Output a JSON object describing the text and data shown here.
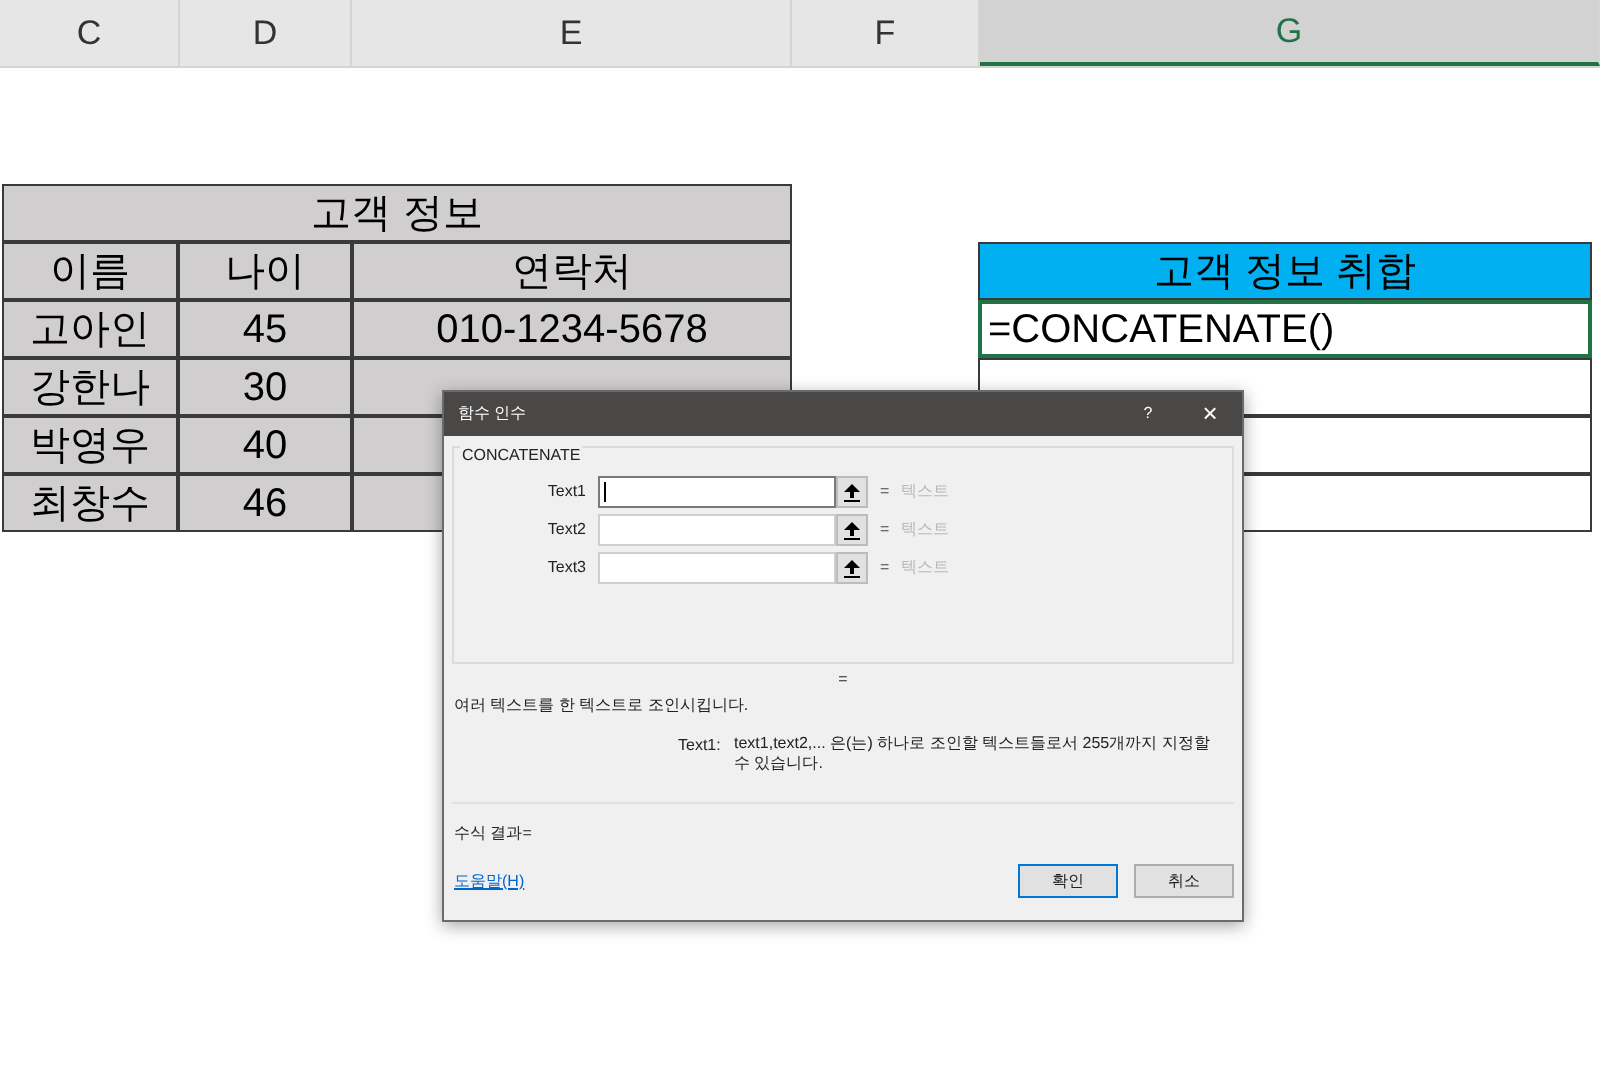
{
  "column_headers": [
    {
      "label": "C",
      "selected": false
    },
    {
      "label": "D",
      "selected": false
    },
    {
      "label": "E",
      "selected": false
    },
    {
      "label": "F",
      "selected": false
    },
    {
      "label": "G",
      "selected": true
    }
  ],
  "customer_table": {
    "title": "고객 정보",
    "columns": [
      "이름",
      "나이",
      "연락처"
    ],
    "rows": [
      {
        "name": "고아인",
        "age": "45",
        "phone": "010-1234-5678"
      },
      {
        "name": "강한나",
        "age": "30"
      },
      {
        "name": "박영우",
        "age": "40"
      },
      {
        "name": "최창수",
        "age": "46"
      }
    ]
  },
  "merge_table": {
    "title": "고객 정보 취합",
    "cells": [
      {
        "value": "=CONCATENATE()",
        "selected": true
      },
      {
        "selected": false
      },
      {
        "selected": false
      },
      {
        "selected": false
      }
    ]
  },
  "dialog": {
    "title": "함수 인수",
    "help": "?",
    "close": "×",
    "function_name": "CONCATENATE",
    "args": [
      {
        "label": "Text1",
        "focused": true,
        "result": "텍스트"
      },
      {
        "label": "Text2",
        "focused": false,
        "result": "텍스트"
      },
      {
        "label": "Text3",
        "focused": false,
        "result": "텍스트"
      }
    ],
    "equals": "=",
    "result_sign": "=",
    "description": "여러 텍스트를 한 텍스트로 조인시킵니다.",
    "arg_label": "Text1:",
    "arg_description": "text1,text2,... 은(는) 하나로 조인할 텍스트들로서 255개까지 지정할 수 있습니다.",
    "formula_result": "수식 결과=",
    "help_link": "도움말(H)",
    "ok": "확인",
    "cancel": "취소"
  }
}
